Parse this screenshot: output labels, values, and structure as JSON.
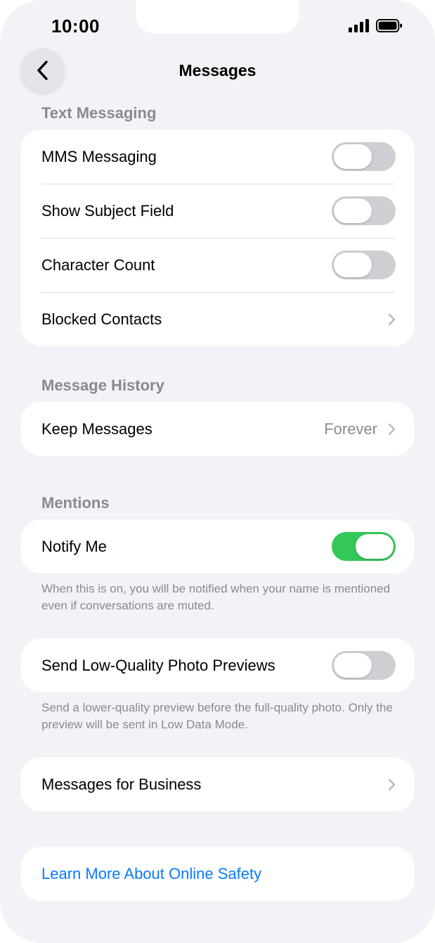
{
  "status_bar": {
    "time": "10:00"
  },
  "nav": {
    "title": "Messages"
  },
  "sections": {
    "text_messaging": {
      "header": "Text Messaging",
      "mms": {
        "label": "MMS Messaging",
        "on": false
      },
      "subject": {
        "label": "Show Subject Field",
        "on": false
      },
      "char_count": {
        "label": "Character Count",
        "on": false
      },
      "blocked": {
        "label": "Blocked Contacts"
      }
    },
    "message_history": {
      "header": "Message History",
      "keep": {
        "label": "Keep Messages",
        "value": "Forever"
      }
    },
    "mentions": {
      "header": "Mentions",
      "notify": {
        "label": "Notify Me",
        "on": true
      },
      "footnote": "When this is on, you will be notified when your name is mentioned even if conversations are muted."
    },
    "photo_previews": {
      "low_quality": {
        "label": "Send Low-Quality Photo Previews",
        "on": false
      },
      "footnote": "Send a lower-quality preview before the full-quality photo. Only the preview will be sent in Low Data Mode."
    },
    "business": {
      "label": "Messages for Business"
    },
    "safety": {
      "label": "Learn More About Online Safety"
    }
  },
  "colors": {
    "background": "#f2f2f7",
    "toggle_on": "#34c759",
    "toggle_off": "#cfcfd3",
    "link": "#0a7aff",
    "secondary_text": "#8a8a8e"
  },
  "icons": {
    "back": "chevron-left-icon",
    "disclosure": "chevron-right-icon",
    "signal": "cellular-signal-icon",
    "battery": "battery-icon"
  }
}
